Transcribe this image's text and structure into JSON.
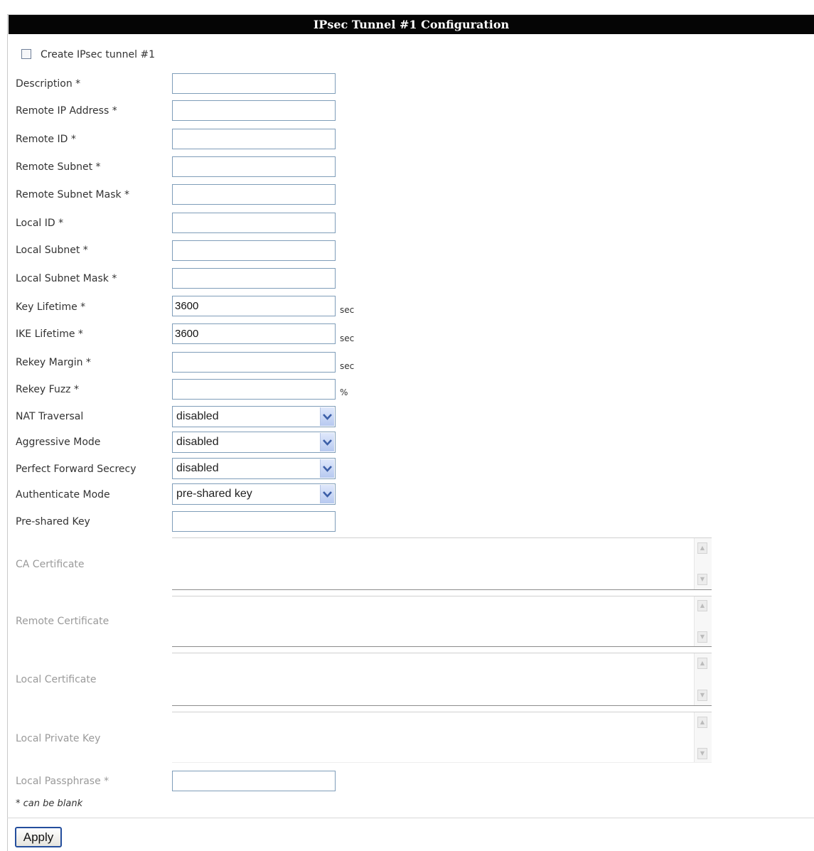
{
  "header": {
    "title": "IPsec Tunnel #1 Configuration"
  },
  "create_tunnel": {
    "label": "Create IPsec tunnel #1",
    "checked": false
  },
  "fields": {
    "description": {
      "label": "Description *",
      "value": ""
    },
    "remote_ip": {
      "label": "Remote IP Address *",
      "value": ""
    },
    "remote_id": {
      "label": "Remote ID *",
      "value": ""
    },
    "remote_subnet": {
      "label": "Remote Subnet *",
      "value": ""
    },
    "remote_subnet_mask": {
      "label": "Remote Subnet Mask *",
      "value": ""
    },
    "local_id": {
      "label": "Local ID *",
      "value": ""
    },
    "local_subnet": {
      "label": "Local Subnet *",
      "value": ""
    },
    "local_subnet_mask": {
      "label": "Local Subnet Mask *",
      "value": ""
    },
    "key_lifetime": {
      "label": "Key Lifetime *",
      "value": "3600",
      "unit": "sec"
    },
    "ike_lifetime": {
      "label": "IKE Lifetime *",
      "value": "3600",
      "unit": "sec"
    },
    "rekey_margin": {
      "label": "Rekey Margin *",
      "value": "",
      "unit": "sec"
    },
    "rekey_fuzz": {
      "label": "Rekey Fuzz *",
      "value": "",
      "unit": "%"
    },
    "nat_traversal": {
      "label": "NAT Traversal",
      "value": "disabled"
    },
    "aggressive_mode": {
      "label": "Aggressive Mode",
      "value": "disabled"
    },
    "pfs": {
      "label": "Perfect Forward Secrecy",
      "value": "disabled"
    },
    "auth_mode": {
      "label": "Authenticate Mode",
      "value": "pre-shared key"
    },
    "psk": {
      "label": "Pre-shared Key",
      "value": ""
    },
    "ca_cert": {
      "label": "CA Certificate"
    },
    "remote_cert": {
      "label": "Remote Certificate"
    },
    "local_cert": {
      "label": "Local Certificate"
    },
    "local_private_key": {
      "label": "Local Private Key"
    },
    "local_passphrase": {
      "label": "Local Passphrase *",
      "value": ""
    }
  },
  "note": "* can be blank",
  "apply_label": "Apply",
  "icons": {
    "dropdown": "chevron-down-icon",
    "scroll_up": "arrow-up-icon",
    "scroll_down": "arrow-down-icon"
  },
  "colors": {
    "header_bg": "#050505",
    "input_border": "#7f9db9",
    "disabled_text": "#9a9a9a"
  }
}
